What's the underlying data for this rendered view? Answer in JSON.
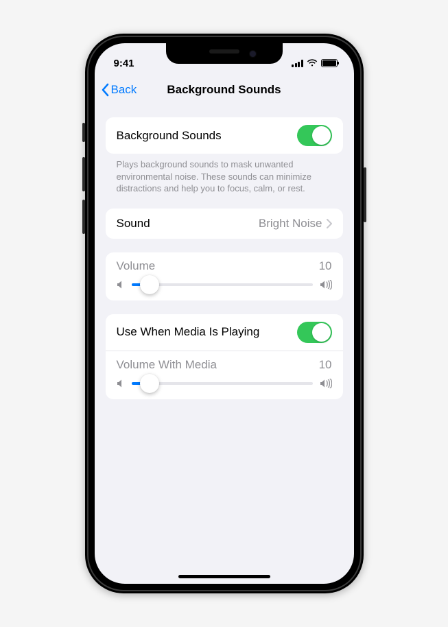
{
  "status": {
    "time": "9:41"
  },
  "nav": {
    "back": "Back",
    "title": "Background Sounds"
  },
  "main_toggle": {
    "label": "Background Sounds",
    "on": true,
    "description": "Plays background sounds to mask unwanted environmental noise. These sounds can minimize distractions and help you to focus, calm, or rest."
  },
  "sound": {
    "label": "Sound",
    "value": "Bright Noise"
  },
  "volume": {
    "label": "Volume",
    "value": "10",
    "percent": 10
  },
  "media": {
    "toggle_label": "Use When Media Is Playing",
    "toggle_on": true,
    "slider_label": "Volume With Media",
    "slider_value": "10",
    "slider_percent": 10
  }
}
